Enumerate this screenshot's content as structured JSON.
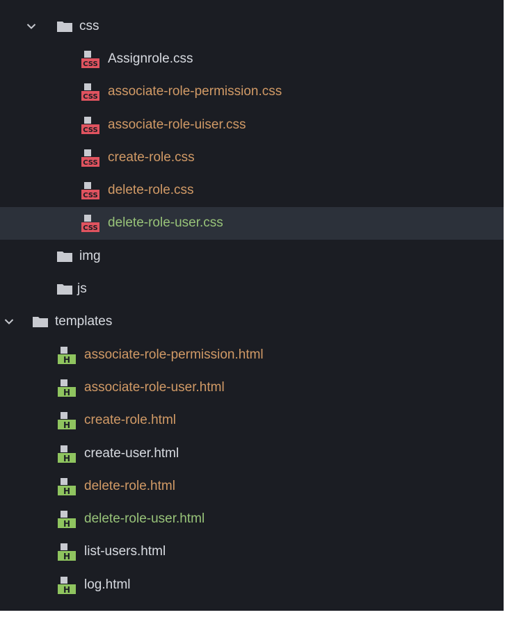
{
  "colors": {
    "background": "#1b1d23",
    "selected_row": "#2c313a",
    "text_default": "#d7dae0",
    "text_modified": "#d19a66",
    "text_added": "#98c379",
    "css_badge": "#e0535f",
    "html_badge": "#8fc45f",
    "folder": "#c8cad0"
  },
  "tree": {
    "css_folder": {
      "label": "css",
      "expanded": true,
      "icon": "folder-icon"
    },
    "css_files": [
      {
        "label": "Assignrole.css",
        "status": "default",
        "icon": "css-file-icon"
      },
      {
        "label": "associate-role-permission.css",
        "status": "modified",
        "icon": "css-file-icon"
      },
      {
        "label": "associate-role-uiser.css",
        "status": "modified",
        "icon": "css-file-icon"
      },
      {
        "label": "create-role.css",
        "status": "modified",
        "icon": "css-file-icon"
      },
      {
        "label": "delete-role.css",
        "status": "modified",
        "icon": "css-file-icon"
      },
      {
        "label": "delete-role-user.css",
        "status": "added",
        "icon": "css-file-icon",
        "selected": true
      }
    ],
    "img_folder": {
      "label": "img",
      "expanded": false,
      "icon": "folder-icon"
    },
    "js_folder": {
      "label": "js",
      "expanded": false,
      "icon": "folder-icon"
    },
    "templates_folder": {
      "label": "templates",
      "expanded": true,
      "icon": "folder-icon"
    },
    "template_files": [
      {
        "label": "associate-role-permission.html",
        "status": "modified",
        "icon": "html-file-icon"
      },
      {
        "label": "associate-role-user.html",
        "status": "modified",
        "icon": "html-file-icon"
      },
      {
        "label": "create-role.html",
        "status": "modified",
        "icon": "html-file-icon"
      },
      {
        "label": "create-user.html",
        "status": "default",
        "icon": "html-file-icon"
      },
      {
        "label": "delete-role.html",
        "status": "modified",
        "icon": "html-file-icon"
      },
      {
        "label": "delete-role-user.html",
        "status": "added",
        "icon": "html-file-icon"
      },
      {
        "label": "list-users.html",
        "status": "default",
        "icon": "html-file-icon"
      },
      {
        "label": "log.html",
        "status": "default",
        "icon": "html-file-icon"
      }
    ]
  }
}
